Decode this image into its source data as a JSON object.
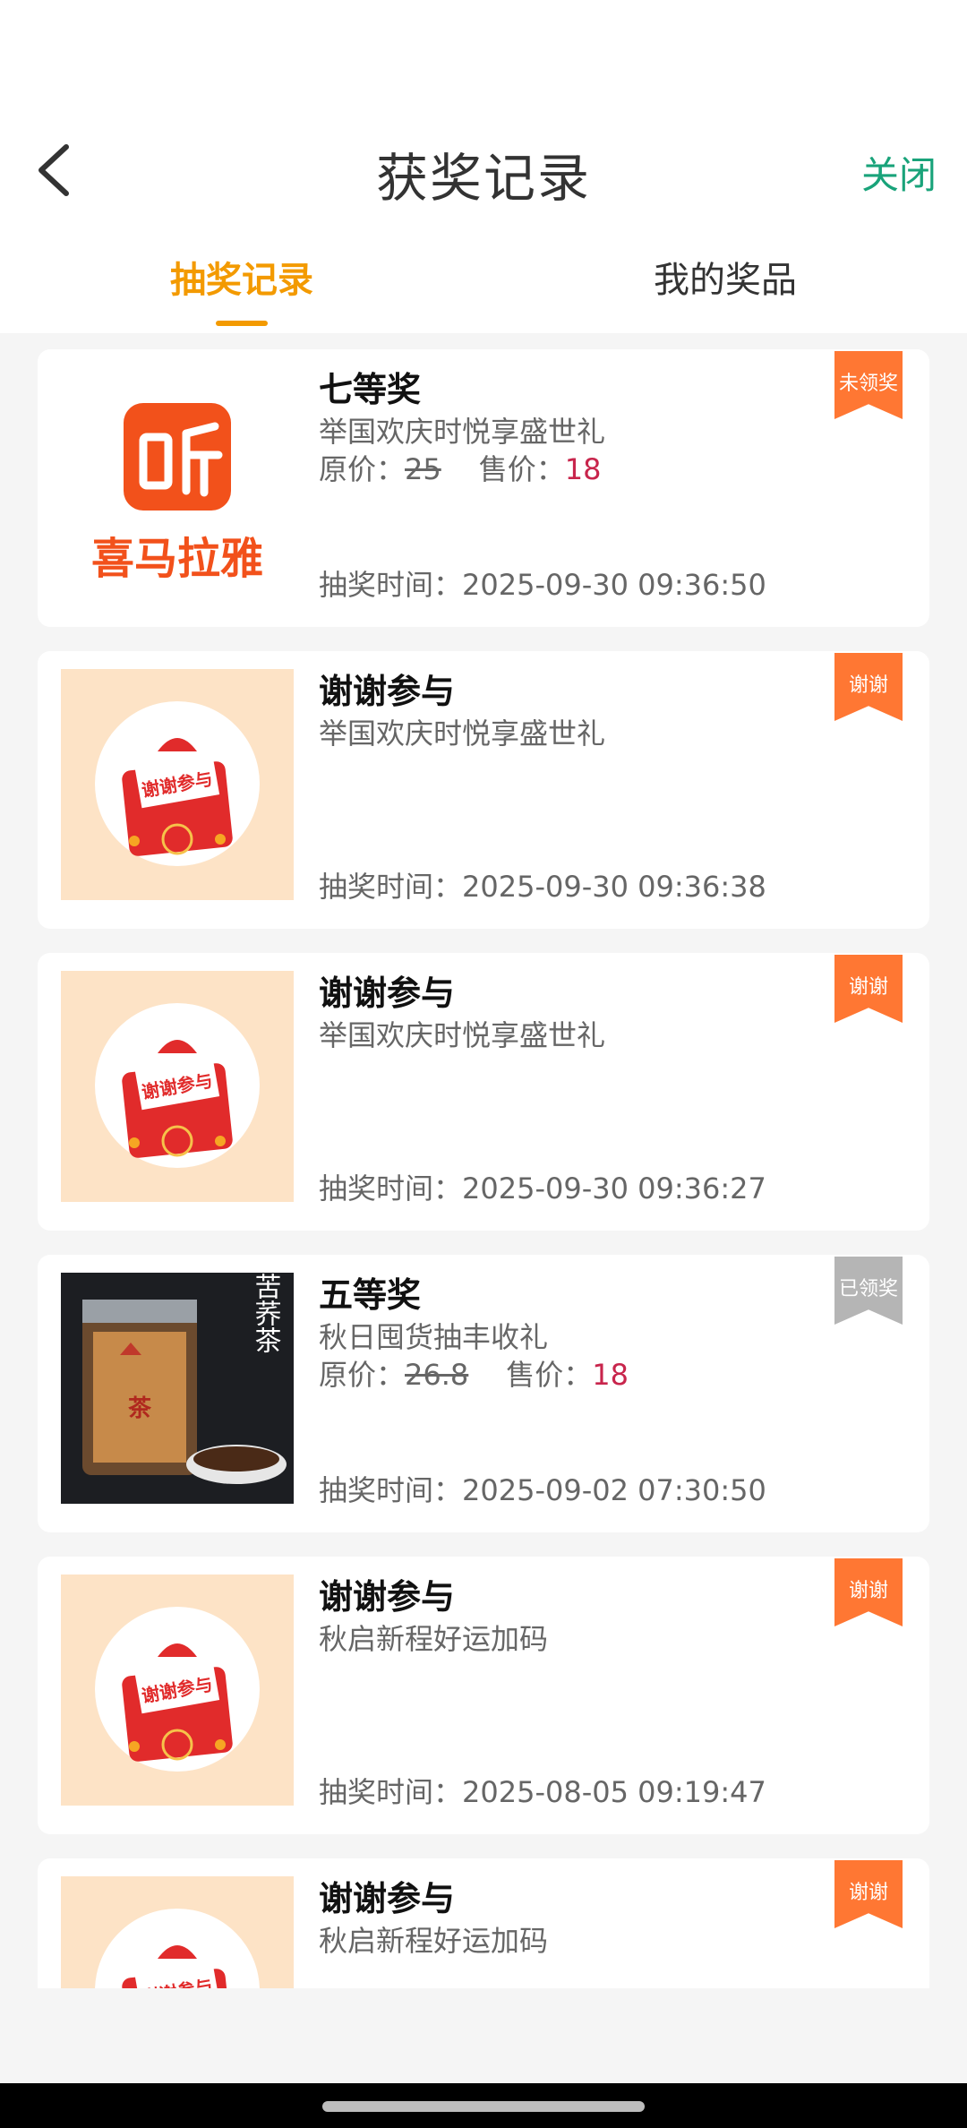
{
  "header": {
    "title": "获奖记录",
    "close_label": "关闭"
  },
  "tabs": [
    {
      "label": "抽奖记录",
      "active": true
    },
    {
      "label": "我的奖品",
      "active": false
    }
  ],
  "colors": {
    "accent": "#f39a00",
    "close": "#19a37a",
    "badge_orange": "#ff7733",
    "badge_grey": "#b5b5b5",
    "sale_price": "#c8254c"
  },
  "labels": {
    "orig_price": "原价：",
    "sale_price": "售价：",
    "draw_time": "抽奖时间："
  },
  "records": [
    {
      "prize": "七等奖",
      "event": "举国欢庆时悦享盛世礼",
      "orig_price": "25",
      "sale_price": "18",
      "time": "2025-09-30 09:36:50",
      "badge": "未领奖",
      "badge_color": "orange",
      "image": "ximalaya-logo",
      "logo_text": "喜马拉雅"
    },
    {
      "prize": "谢谢参与",
      "event": "举国欢庆时悦享盛世礼",
      "time": "2025-09-30 09:36:38",
      "badge": "谢谢",
      "badge_color": "orange",
      "image": "thanks-envelope",
      "envelope_text": "谢谢参与"
    },
    {
      "prize": "谢谢参与",
      "event": "举国欢庆时悦享盛世礼",
      "time": "2025-09-30 09:36:27",
      "badge": "谢谢",
      "badge_color": "orange",
      "image": "thanks-envelope",
      "envelope_text": "谢谢参与"
    },
    {
      "prize": "五等奖",
      "event": "秋日囤货抽丰收礼",
      "orig_price": "26.8",
      "sale_price": "18",
      "time": "2025-09-02 07:30:50",
      "badge": "已领奖",
      "badge_color": "grey",
      "image": "black-tartary-tea",
      "tea_title": "黑苦荞茶"
    },
    {
      "prize": "谢谢参与",
      "event": "秋启新程好运加码",
      "time": "2025-08-05 09:19:47",
      "badge": "谢谢",
      "badge_color": "orange",
      "image": "thanks-envelope",
      "envelope_text": "谢谢参与"
    },
    {
      "prize": "谢谢参与",
      "event": "秋启新程好运加码",
      "badge": "谢谢",
      "badge_color": "orange",
      "image": "thanks-envelope",
      "envelope_text": "谢谢参与"
    }
  ]
}
